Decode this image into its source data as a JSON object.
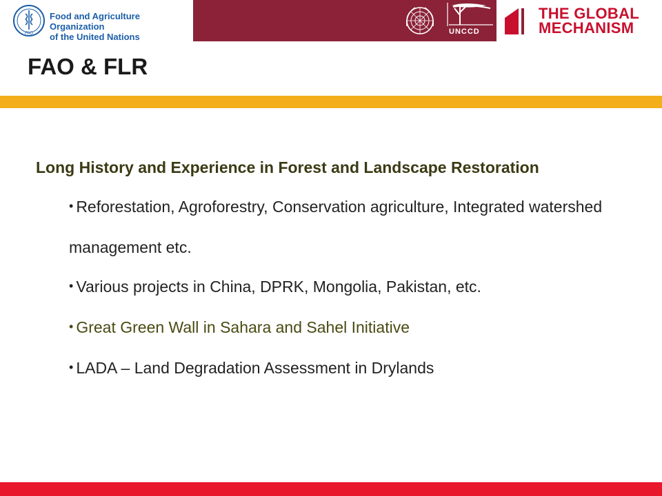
{
  "header": {
    "fao_name_line1": "Food and Agriculture Organization",
    "fao_name_line2": "of the United Nations",
    "unccd_label": "UNCCD",
    "gm_line1": "THE GLOBAL",
    "gm_line2": "MECHANISM",
    "fao_emblem_text": "FAO",
    "colors": {
      "maroon": "#8b2238",
      "fao_blue": "#1b5ea8",
      "gm_red": "#c8102e"
    }
  },
  "slide": {
    "title": "FAO & FLR",
    "lead": "Long History and Experience in Forest and Landscape Restoration",
    "bullets": [
      {
        "text": "Reforestation, Agroforestry, Conservation agriculture, Integrated watershed management etc."
      },
      {
        "text": "Various projects in China, DPRK, Mongolia, Pakistan, etc."
      },
      {
        "text": "Great Green Wall in Sahara and Sahel Initiative"
      },
      {
        "text": "LADA – Land Degradation Assessment in Drylands"
      }
    ]
  },
  "colors": {
    "accent_gold": "#f3ae1b",
    "footer_red": "#e8172c"
  }
}
